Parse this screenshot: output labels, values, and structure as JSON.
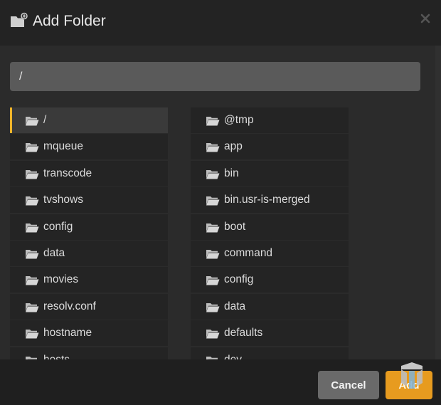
{
  "dialog": {
    "title": "Add Folder",
    "close_icon": "close-icon",
    "header_icon": "folder-plus-icon"
  },
  "path_input": {
    "value": "/"
  },
  "folders": {
    "left": [
      {
        "label": "/",
        "selected": true
      },
      {
        "label": "mqueue"
      },
      {
        "label": "transcode"
      },
      {
        "label": "tvshows"
      },
      {
        "label": "config"
      },
      {
        "label": "data"
      },
      {
        "label": "movies"
      },
      {
        "label": "resolv.conf"
      },
      {
        "label": "hostname"
      },
      {
        "label": "hosts"
      }
    ],
    "right": [
      {
        "label": "@tmp"
      },
      {
        "label": "app"
      },
      {
        "label": "bin"
      },
      {
        "label": "bin.usr-is-merged"
      },
      {
        "label": "boot"
      },
      {
        "label": "command"
      },
      {
        "label": "config"
      },
      {
        "label": "data"
      },
      {
        "label": "defaults"
      },
      {
        "label": "dev"
      }
    ]
  },
  "footer": {
    "cancel_label": "Cancel",
    "add_label": "Add"
  },
  "colors": {
    "accent": "#e79b1f",
    "selection_bar": "#f0b429"
  }
}
